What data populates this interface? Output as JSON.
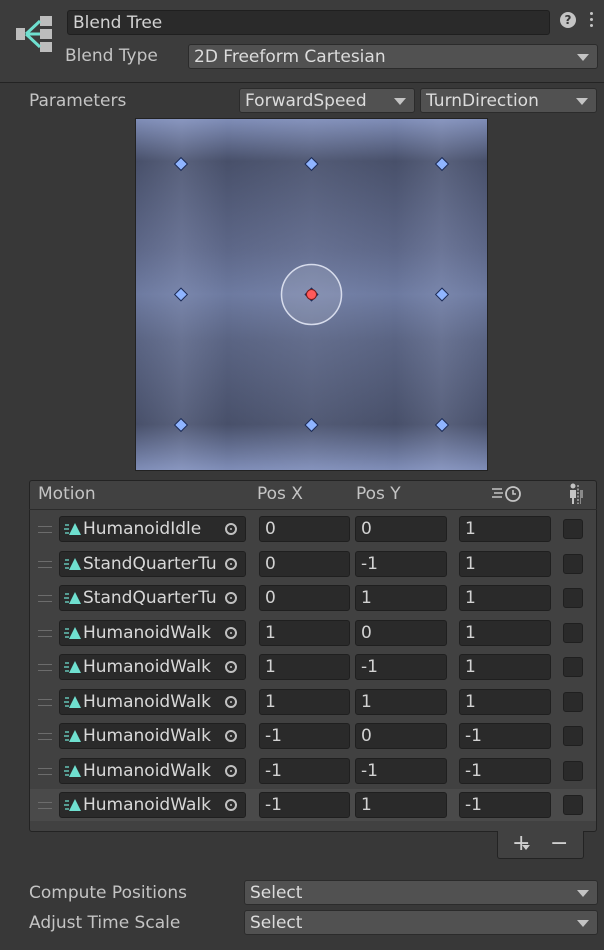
{
  "header": {
    "name_value": "Blend Tree",
    "blend_type_label": "Blend Type",
    "blend_type_value": "2D Freeform Cartesian",
    "help_icon": "question-icon",
    "menu_icon": "kebab-icon"
  },
  "parameters": {
    "label": "Parameters",
    "param_x": "ForwardSpeed",
    "param_y": "TurnDirection"
  },
  "graph": {
    "points": [
      {
        "x": -1,
        "y": 1
      },
      {
        "x": 0,
        "y": 1
      },
      {
        "x": 1,
        "y": 1
      },
      {
        "x": -1,
        "y": 0
      },
      {
        "x": 0,
        "y": 0
      },
      {
        "x": 1,
        "y": 0
      },
      {
        "x": -1,
        "y": -1
      },
      {
        "x": 0,
        "y": -1
      },
      {
        "x": 1,
        "y": -1
      }
    ],
    "current": {
      "x": 0,
      "y": 0
    },
    "point_color": "#8fb4ff",
    "current_color": "#ff5a5a"
  },
  "motion_list": {
    "headers": {
      "motion": "Motion",
      "pos_x": "Pos X",
      "pos_y": "Pos Y",
      "speed_icon": "timescale-icon",
      "mirror_icon": "mirror-icon"
    },
    "rows": [
      {
        "motion": "HumanoidIdle",
        "pos_x": "0",
        "pos_y": "0",
        "speed": "1",
        "mirror": false
      },
      {
        "motion": "StandQuarterTu",
        "pos_x": "0",
        "pos_y": "-1",
        "speed": "1",
        "mirror": false
      },
      {
        "motion": "StandQuarterTu",
        "pos_x": "0",
        "pos_y": "1",
        "speed": "1",
        "mirror": false
      },
      {
        "motion": "HumanoidWalk",
        "pos_x": "1",
        "pos_y": "0",
        "speed": "1",
        "mirror": false
      },
      {
        "motion": "HumanoidWalk",
        "pos_x": "1",
        "pos_y": "-1",
        "speed": "1",
        "mirror": false
      },
      {
        "motion": "HumanoidWalk",
        "pos_x": "1",
        "pos_y": "1",
        "speed": "1",
        "mirror": false
      },
      {
        "motion": "HumanoidWalk",
        "pos_x": "-1",
        "pos_y": "0",
        "speed": "-1",
        "mirror": false
      },
      {
        "motion": "HumanoidWalk",
        "pos_x": "-1",
        "pos_y": "-1",
        "speed": "-1",
        "mirror": false
      },
      {
        "motion": "HumanoidWalk",
        "pos_x": "-1",
        "pos_y": "1",
        "speed": "-1",
        "mirror": false
      }
    ],
    "add_button": "+",
    "remove_button": "−"
  },
  "footer": {
    "compute_label": "Compute Positions",
    "compute_value": "Select",
    "adjust_label": "Adjust Time Scale",
    "adjust_value": "Select"
  },
  "colors": {
    "accent_icon": "#6fe0d0",
    "background": "#383838"
  }
}
